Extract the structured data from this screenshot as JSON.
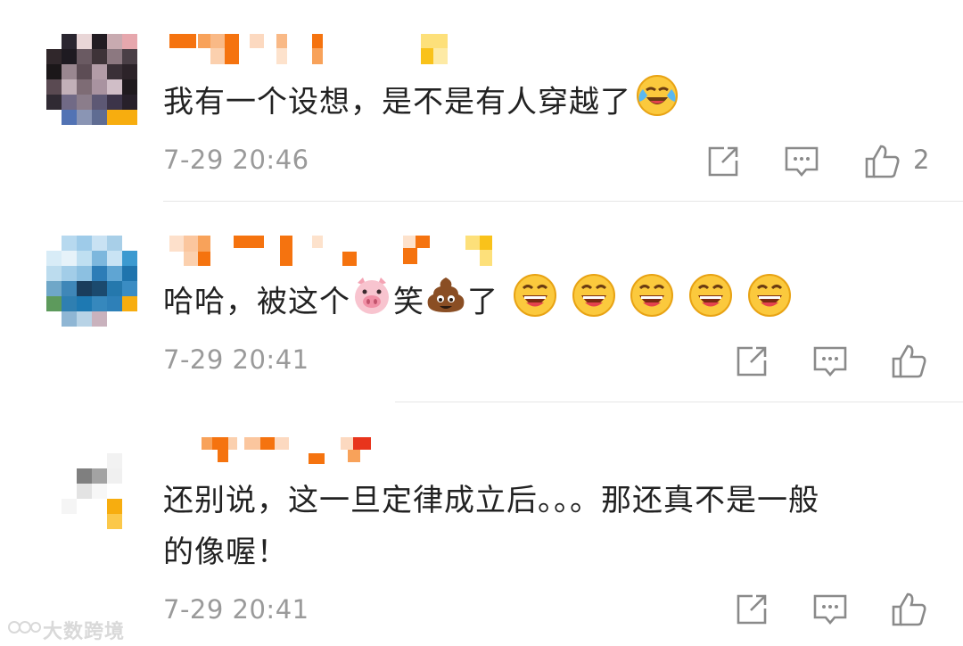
{
  "comments": [
    {
      "text": "我有一个设想，是不是有人穿越了",
      "emojis": [
        "laugh-cry-emoji"
      ],
      "time": "7-29 20:46",
      "likes": "2"
    },
    {
      "text": "哈哈，被这个",
      "text2": "笑",
      "text3": "了",
      "emojis": [
        "pig-face-emoji",
        "poop-emoji",
        "laughing-emoji",
        "laughing-emoji",
        "laughing-emoji",
        "laughing-emoji",
        "laughing-emoji"
      ],
      "time": "7-29 20:41",
      "likes": ""
    },
    {
      "text": "还别说，这一旦定律成立后。。。那还真不是一般",
      "text_line2": "的像喔！",
      "time": "7-29 20:41",
      "likes": ""
    }
  ],
  "watermark": "大数跨境",
  "colors": {
    "accent_orange": "#f5730f",
    "muted_gray": "#9a9a9a",
    "divider": "#e6e6e6"
  },
  "icons": {
    "share": "share-icon",
    "reply": "comment-icon",
    "like": "thumb-up-icon"
  }
}
